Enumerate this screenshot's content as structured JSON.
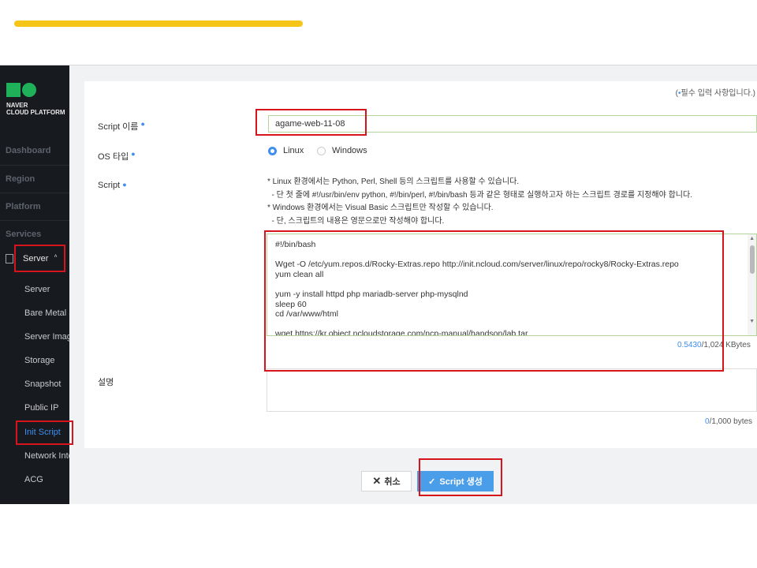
{
  "sidebar": {
    "logo_text": "NAVER\nCLOUD PLATFORM",
    "main_items": [
      "Dashboard",
      "Region",
      "Platform",
      "Services"
    ],
    "server_label": "Server",
    "sub_items": [
      "Server",
      "Bare Metal S",
      "Server Imag",
      "Storage",
      "Snapshot",
      "Public IP",
      "Init Script",
      "Network Inte",
      "ACG"
    ]
  },
  "form": {
    "required_note": "필수 입력 사항입니다.)",
    "required_open": "(",
    "script_name_label": "Script 이름",
    "script_name_value": "agame-web-11-08",
    "os_label": "OS 타입",
    "os_options": [
      "Linux",
      "Windows"
    ],
    "os_selected": "Linux",
    "script_label": "Script",
    "guide_text": "* Linux 환경에서는 Python, Perl, Shell 등의 스크립트를 사용할 수 있습니다.\n  - 단 첫 줄에 #!/usr/bin/env python, #!/bin/perl, #!/bin/bash 등과 같은 형태로 실행하고자 하는 스크립트 경로를 지정해야 합니다.\n* Windows 환경에서는 Visual Basic 스크립트만 작성할 수 있습니다.\n  - 단, 스크립트의 내용은 영문으로만 작성해야 합니다.",
    "script_content": "#!/bin/bash\n\nWget -O /etc/yum.repos.d/Rocky-Extras.repo http://init.ncloud.com/server/linux/repo/rocky8/Rocky-Extras.repo\nyum clean all\n\nyum -y install httpd php mariadb-server php-mysqlnd\nsleep 60\ncd /var/www/html\n\nwget https://kr.object.ncloudstorage.com/ncp-manual/handson/lab.tar",
    "script_size_used": "0.5430",
    "script_size_limit": "/1,024 KBytes",
    "desc_label": "설명",
    "desc_count_used": "0",
    "desc_count_limit": "/1,000 bytes"
  },
  "buttons": {
    "cancel": "취소",
    "create": "Script 생성"
  },
  "colors": {
    "accent": "#3f8ef0",
    "highlight": "#d6141c",
    "top_bar": "#f5c518",
    "sidebar_bg": "#171a1f"
  }
}
